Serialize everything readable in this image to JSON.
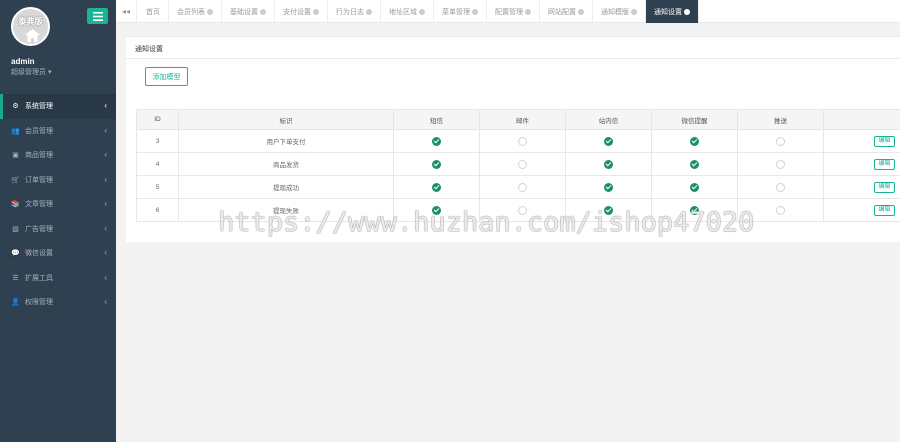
{
  "sidebar": {
    "avatar_text": "泰典版",
    "user_name": "admin",
    "user_role": "超级管理员",
    "items": [
      {
        "label": "系统管理",
        "icon": "gear-icon",
        "glyph": "⚙",
        "active": true
      },
      {
        "label": "会员管理",
        "icon": "users-icon",
        "glyph": "👥",
        "active": false
      },
      {
        "label": "商品管理",
        "icon": "box-icon",
        "glyph": "▣",
        "active": false
      },
      {
        "label": "订单管理",
        "icon": "cart-icon",
        "glyph": "🛒",
        "active": false
      },
      {
        "label": "文章管理",
        "icon": "book-icon",
        "glyph": "📚",
        "active": false
      },
      {
        "label": "广告管理",
        "icon": "image-icon",
        "glyph": "▧",
        "active": false
      },
      {
        "label": "微信设置",
        "icon": "wechat-icon",
        "glyph": "💬",
        "active": false
      },
      {
        "label": "扩展工具",
        "icon": "list-icon",
        "glyph": "☰",
        "active": false
      },
      {
        "label": "权限管理",
        "icon": "user-icon",
        "glyph": "👤",
        "active": false
      }
    ]
  },
  "tabs": [
    {
      "label": "首页",
      "closable": false,
      "active": false
    },
    {
      "label": "会员列表",
      "closable": true,
      "active": false
    },
    {
      "label": "基础设置",
      "closable": true,
      "active": false
    },
    {
      "label": "支付设置",
      "closable": true,
      "active": false
    },
    {
      "label": "行为日志",
      "closable": true,
      "active": false
    },
    {
      "label": "地址区域",
      "closable": true,
      "active": false
    },
    {
      "label": "菜单管理",
      "closable": true,
      "active": false
    },
    {
      "label": "配置管理",
      "closable": true,
      "active": false
    },
    {
      "label": "网站配置",
      "closable": true,
      "active": false
    },
    {
      "label": "通知模版",
      "closable": true,
      "active": false
    },
    {
      "label": "通知设置",
      "closable": true,
      "active": true
    }
  ],
  "panel": {
    "title": "通知设置",
    "add_button": "添加模型"
  },
  "table": {
    "headers": [
      "ID",
      "标识",
      "短信",
      "邮件",
      "站内信",
      "微信提醒",
      "推送",
      ""
    ],
    "rows": [
      {
        "id": "3",
        "name": "用户下单支付",
        "sms": true,
        "email": false,
        "inbox": true,
        "wechat": true,
        "push": false,
        "action": "编辑"
      },
      {
        "id": "4",
        "name": "商品发货",
        "sms": true,
        "email": false,
        "inbox": true,
        "wechat": true,
        "push": false,
        "action": "编辑"
      },
      {
        "id": "5",
        "name": "提现成功",
        "sms": true,
        "email": false,
        "inbox": true,
        "wechat": true,
        "push": false,
        "action": "编辑"
      },
      {
        "id": "6",
        "name": "提现失败",
        "sms": true,
        "email": false,
        "inbox": true,
        "wechat": true,
        "push": false,
        "action": "编辑"
      }
    ]
  },
  "watermark": "https://www.huzhan.com/ishop47020",
  "colors": {
    "sidebar": "#2f4050",
    "accent": "#1ab394",
    "check": "#1c8f69"
  }
}
